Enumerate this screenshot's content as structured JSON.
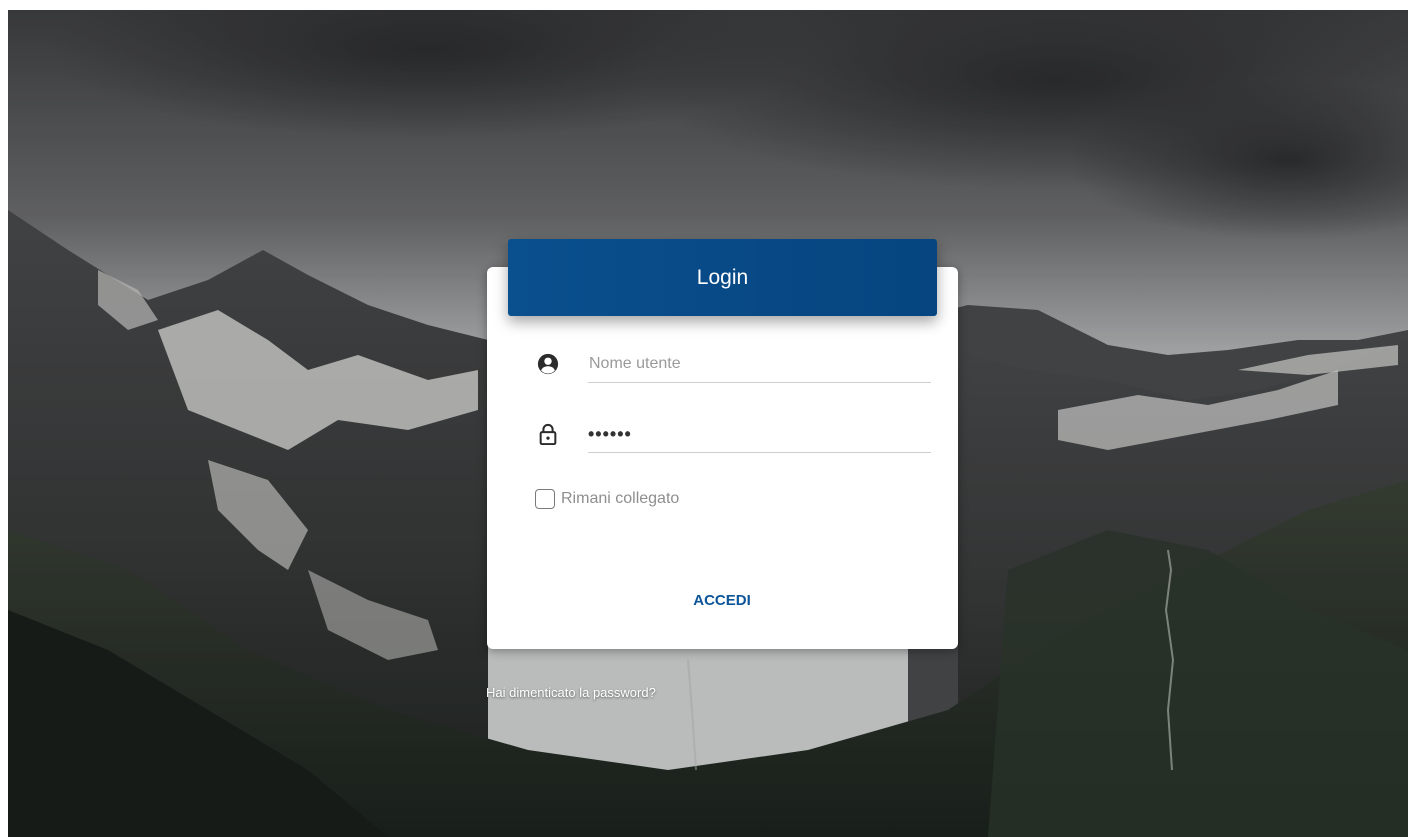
{
  "login": {
    "title": "Login",
    "username_placeholder": "Nome utente",
    "username_value": "",
    "password_mask": "••••••",
    "remember_label": "Rimani collegato",
    "remember_checked": false,
    "submit_label": "ACCEDI",
    "forgot_link": "Hai dimenticato la password?"
  },
  "icons": {
    "user": "user-circle-icon",
    "password": "lock-icon"
  },
  "colors": {
    "header": "#0a4f8e",
    "accent": "#0b5598"
  }
}
